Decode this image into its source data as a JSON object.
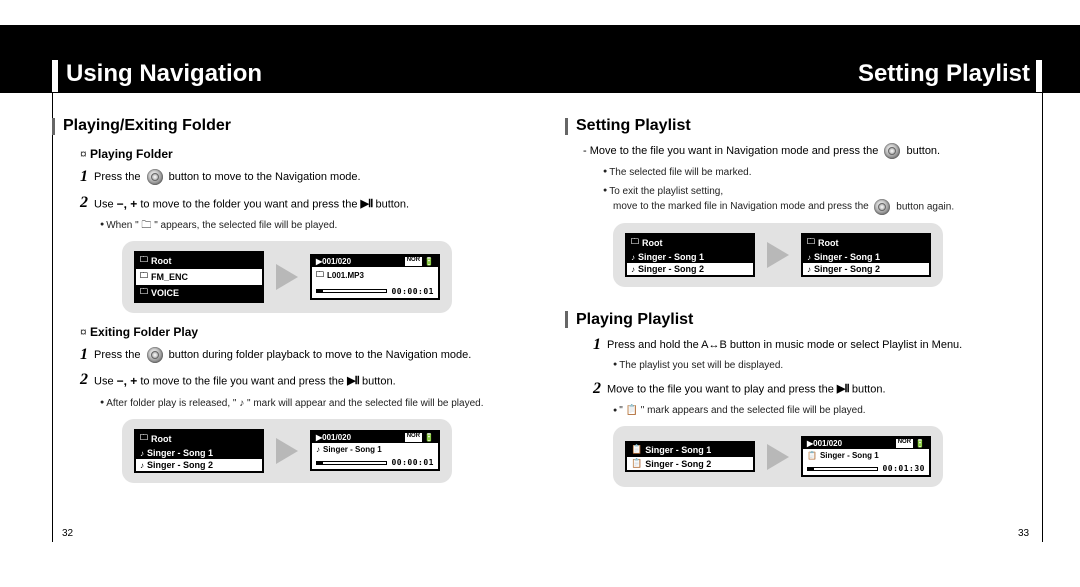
{
  "header": {
    "left_title": "Using Navigation",
    "right_title": "Setting Playlist"
  },
  "left": {
    "section1_title": "Playing/Exiting Folder",
    "sub1": "Playing Folder",
    "s1_step1": "Press the ",
    "s1_step1_b": " button to move to the Navigation mode.",
    "s1_step2_a": "Use ",
    "s1_step2_minusplus": "−, +",
    "s1_step2_b": " to move to the folder you want and press the ",
    "s1_step2_c": " button.",
    "s1_bullet1_a": "When \" ",
    "s1_bullet1_b": " \" appears, the selected file will be played.",
    "folder_icon_label": "🗀",
    "lcd1": {
      "root": "Root",
      "row1": "FM_ENC",
      "row2": "VOICE",
      "play_track": "001/020",
      "play_file": "L001.MP3",
      "play_time": "00:00:01"
    },
    "sub2": "Exiting Folder Play",
    "s2_step1": "Press the ",
    "s2_step1_b": " button during folder playback to move to the Navigation mode.",
    "s2_step2_a": "Use ",
    "s2_step2_minusplus": "−, +",
    "s2_step2_b": " to move to the file you want and press the ",
    "s2_step2_c": " button.",
    "s2_bullet1": "After folder play is released, \" ♪ \" mark will appear and the selected file will be played.",
    "lcd2": {
      "root": "Root",
      "row1": "Singer - Song 1",
      "row2": "Singer - Song 2",
      "play_track": "001/020",
      "play_file": "Singer - Song 1",
      "play_time": "00:00:01"
    },
    "page_num": "32"
  },
  "right": {
    "section1_title": "Setting Playlist",
    "s1_step1_a": "Move to the file you want in Navigation mode and press the ",
    "s1_step1_b": " button.",
    "s1_bullet1": "The selected file will be marked.",
    "s1_bullet2_a": "To exit the playlist setting,",
    "s1_bullet2_b": "move to the marked file in Navigation mode and press the ",
    "s1_bullet2_c": " button again.",
    "lcd1": {
      "root_a": "Root",
      "a_row1": "Singer - Song 1",
      "a_row2": "Singer - Song 2",
      "root_b": "Root",
      "b_row1": "Singer - Song 1",
      "b_row2": "Singer - Song 2"
    },
    "section2_title": "Playing Playlist",
    "s2_step1_a": "Press and hold the A",
    "s2_step1_ab": "↔",
    "s2_step1_b": "B button in music mode or select Playlist in Menu.",
    "s2_bullet1": "The playlist you set will be displayed.",
    "s2_step2_a": "Move to the file you want to play and press the ",
    "s2_step2_b": " button.",
    "s2_bullet2": "\" 📋 \" mark appears and the selected file will be played.",
    "lcd2": {
      "a_row1": "Singer - Song 1",
      "a_row2": "Singer - Song 2",
      "play_track": "001/020",
      "play_file": "Singer - Song 1",
      "play_time": "00:01:30"
    },
    "page_num": "33"
  }
}
